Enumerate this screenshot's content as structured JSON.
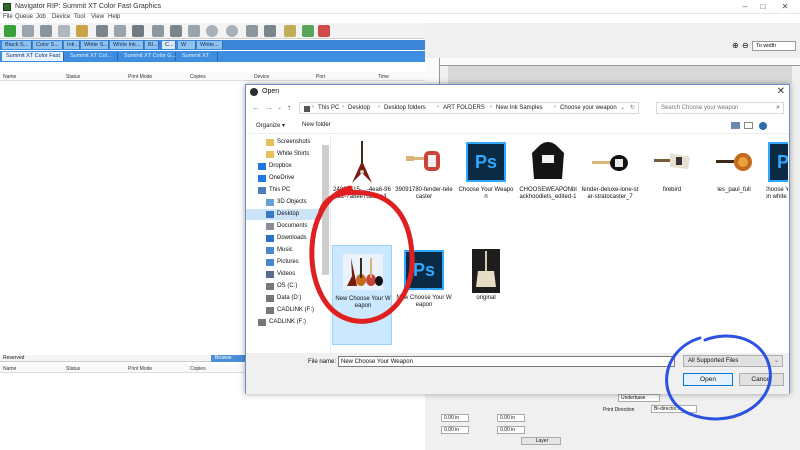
{
  "app": {
    "title": "Navigator RIP: Summit XT Color Fast Graphics",
    "menu": [
      "File",
      "Queue",
      "Job",
      "Device",
      "Tool",
      "View",
      "Help"
    ],
    "queue_tabs": [
      "Black S...",
      "Color S...",
      "Inti...",
      "White S...",
      "White Ink...",
      "Bl...",
      "C...",
      "W",
      "White..."
    ],
    "printer_tabs": [
      "Summit XT Color Fast",
      "Summit XT Col...",
      "Summit XT Color G...",
      "Summit XT"
    ],
    "columns": [
      "Name",
      "Status",
      "Print Mode",
      "Copies",
      "Device",
      "Port",
      "Time"
    ],
    "bottom_tabs": {
      "reserved": "Reserved",
      "browse": "Browse"
    },
    "bottom_columns": [
      "Name",
      "Status",
      "Print Mode",
      "Copies"
    ],
    "zoom": "To width",
    "layer_panel": {
      "underbase": "Underbase",
      "print_direction_label": "Print Direction",
      "print_direction": "Bi-directio...",
      "field_value": "0.00 in",
      "layer_button": "Layer"
    }
  },
  "dialog": {
    "title": "Open",
    "breadcrumb": [
      "This PC",
      "Desktop",
      "Desktop folders",
      "ART FOLDERS",
      "New Ink Samples",
      "Choose your weapon"
    ],
    "search_placeholder": "Search Choose your weapon",
    "organize": "Organize ▾",
    "new_folder": "New folder",
    "nav": [
      {
        "label": "Screenshots",
        "icon": "folder-icon",
        "indent": 2
      },
      {
        "label": "White Shirts",
        "icon": "folder-icon",
        "indent": 2
      },
      {
        "label": "Dropbox",
        "icon": "dropbox-icon",
        "indent": 1
      },
      {
        "label": "OneDrive",
        "icon": "cloud-icon",
        "indent": 1
      },
      {
        "label": "This PC",
        "icon": "computer-icon",
        "indent": 1
      },
      {
        "label": "3D Objects",
        "icon": "cube-icon",
        "indent": 2
      },
      {
        "label": "Desktop",
        "icon": "desktop-icon",
        "indent": 2,
        "selected": true
      },
      {
        "label": "Documents",
        "icon": "documents-icon",
        "indent": 2
      },
      {
        "label": "Downloads",
        "icon": "download-icon",
        "indent": 2
      },
      {
        "label": "Music",
        "icon": "music-icon",
        "indent": 2
      },
      {
        "label": "Pictures",
        "icon": "pictures-icon",
        "indent": 2
      },
      {
        "label": "Videos",
        "icon": "videos-icon",
        "indent": 2
      },
      {
        "label": "OS (C:)",
        "icon": "drive-icon",
        "indent": 2
      },
      {
        "label": "Data (D:)",
        "icon": "drive-icon",
        "indent": 2
      },
      {
        "label": "CADLINK (F:)",
        "icon": "drive-icon",
        "indent": 2
      },
      {
        "label": "CADLINK (F:)",
        "icon": "drive-icon",
        "indent": 1
      }
    ],
    "files": [
      {
        "name": "2481d415-...-4ea6-9692-7a8ee7d281a4",
        "thumb": "flying-v-guitar"
      },
      {
        "name": "39091780-fender-telecaster",
        "thumb": "telecaster"
      },
      {
        "name": "Choose Your Weapon",
        "thumb": "ps"
      },
      {
        "name": "CHOOSEWEAPONblackhoodiets_edited-1",
        "thumb": "hoodie"
      },
      {
        "name": "fender-deluxe-lone-star-stratocaster_7",
        "thumb": "stratocaster"
      },
      {
        "name": "firebird",
        "thumb": "firebird"
      },
      {
        "name": "les_paul_full",
        "thumb": "les-paul"
      },
      {
        "name": "New Choose Your Weapon white shirt",
        "thumb": "ps"
      },
      {
        "name": "New Choose Your Weapon",
        "thumb": "guitars",
        "selected": true
      },
      {
        "name": "New Choose Your Weapon",
        "thumb": "ps"
      },
      {
        "name": "original",
        "thumb": "sg-guitar"
      }
    ],
    "file_name_label": "File name:",
    "file_name_value": "New Choose Your Weapon",
    "filter": "All Supported Files",
    "open_button": "Open",
    "cancel_button": "Cancel"
  },
  "colors": {
    "accent": "#0078d7",
    "tab_blue": "#3d8ee0",
    "selection": "#cce8ff",
    "ps_dark": "#0b2a44",
    "ps_blue": "#31a8ff",
    "annotation_red": "#e02020",
    "annotation_blue": "#2b52e0"
  }
}
